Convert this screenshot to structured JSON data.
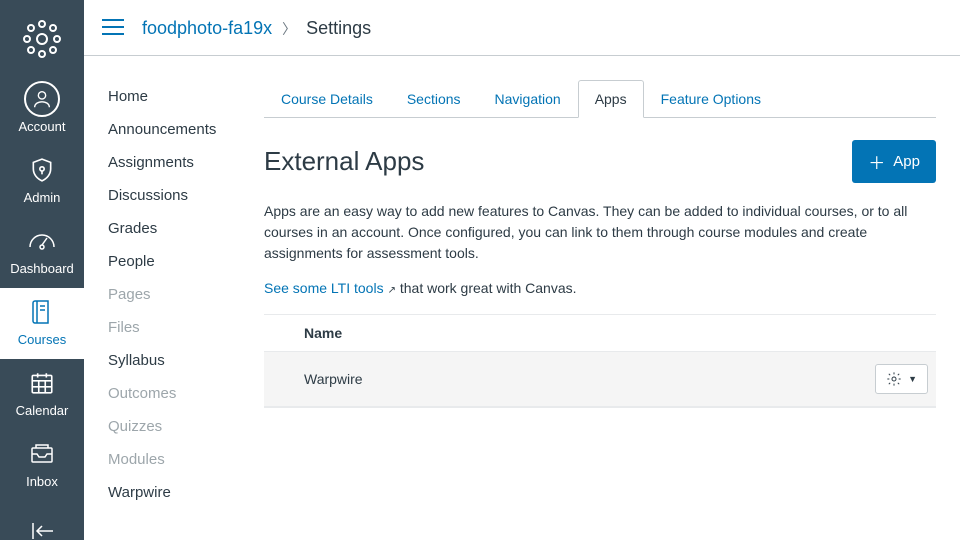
{
  "global_nav": {
    "items": [
      {
        "label": "Account"
      },
      {
        "label": "Admin"
      },
      {
        "label": "Dashboard"
      },
      {
        "label": "Courses"
      },
      {
        "label": "Calendar"
      },
      {
        "label": "Inbox"
      }
    ]
  },
  "breadcrumb": {
    "course": "foodphoto-fa19x",
    "current": "Settings"
  },
  "course_nav": {
    "items": [
      {
        "label": "Home",
        "disabled": false
      },
      {
        "label": "Announcements",
        "disabled": false
      },
      {
        "label": "Assignments",
        "disabled": false
      },
      {
        "label": "Discussions",
        "disabled": false
      },
      {
        "label": "Grades",
        "disabled": false
      },
      {
        "label": "People",
        "disabled": false
      },
      {
        "label": "Pages",
        "disabled": true
      },
      {
        "label": "Files",
        "disabled": true
      },
      {
        "label": "Syllabus",
        "disabled": false
      },
      {
        "label": "Outcomes",
        "disabled": true
      },
      {
        "label": "Quizzes",
        "disabled": true
      },
      {
        "label": "Modules",
        "disabled": true
      },
      {
        "label": "Warpwire",
        "disabled": false
      }
    ]
  },
  "tabs": {
    "items": [
      {
        "label": "Course Details"
      },
      {
        "label": "Sections"
      },
      {
        "label": "Navigation"
      },
      {
        "label": "Apps"
      },
      {
        "label": "Feature Options"
      }
    ],
    "active_index": 3
  },
  "page": {
    "title": "External Apps",
    "add_button": "App",
    "description": "Apps are an easy way to add new features to Canvas. They can be added to individual courses, or to all courses in an account. Once configured, you can link to them through course modules and create assignments for assessment tools.",
    "link_text": "See some LTI tools",
    "link_suffix": " that work great with Canvas.",
    "table": {
      "header": "Name",
      "rows": [
        {
          "name": "Warpwire"
        }
      ]
    }
  }
}
